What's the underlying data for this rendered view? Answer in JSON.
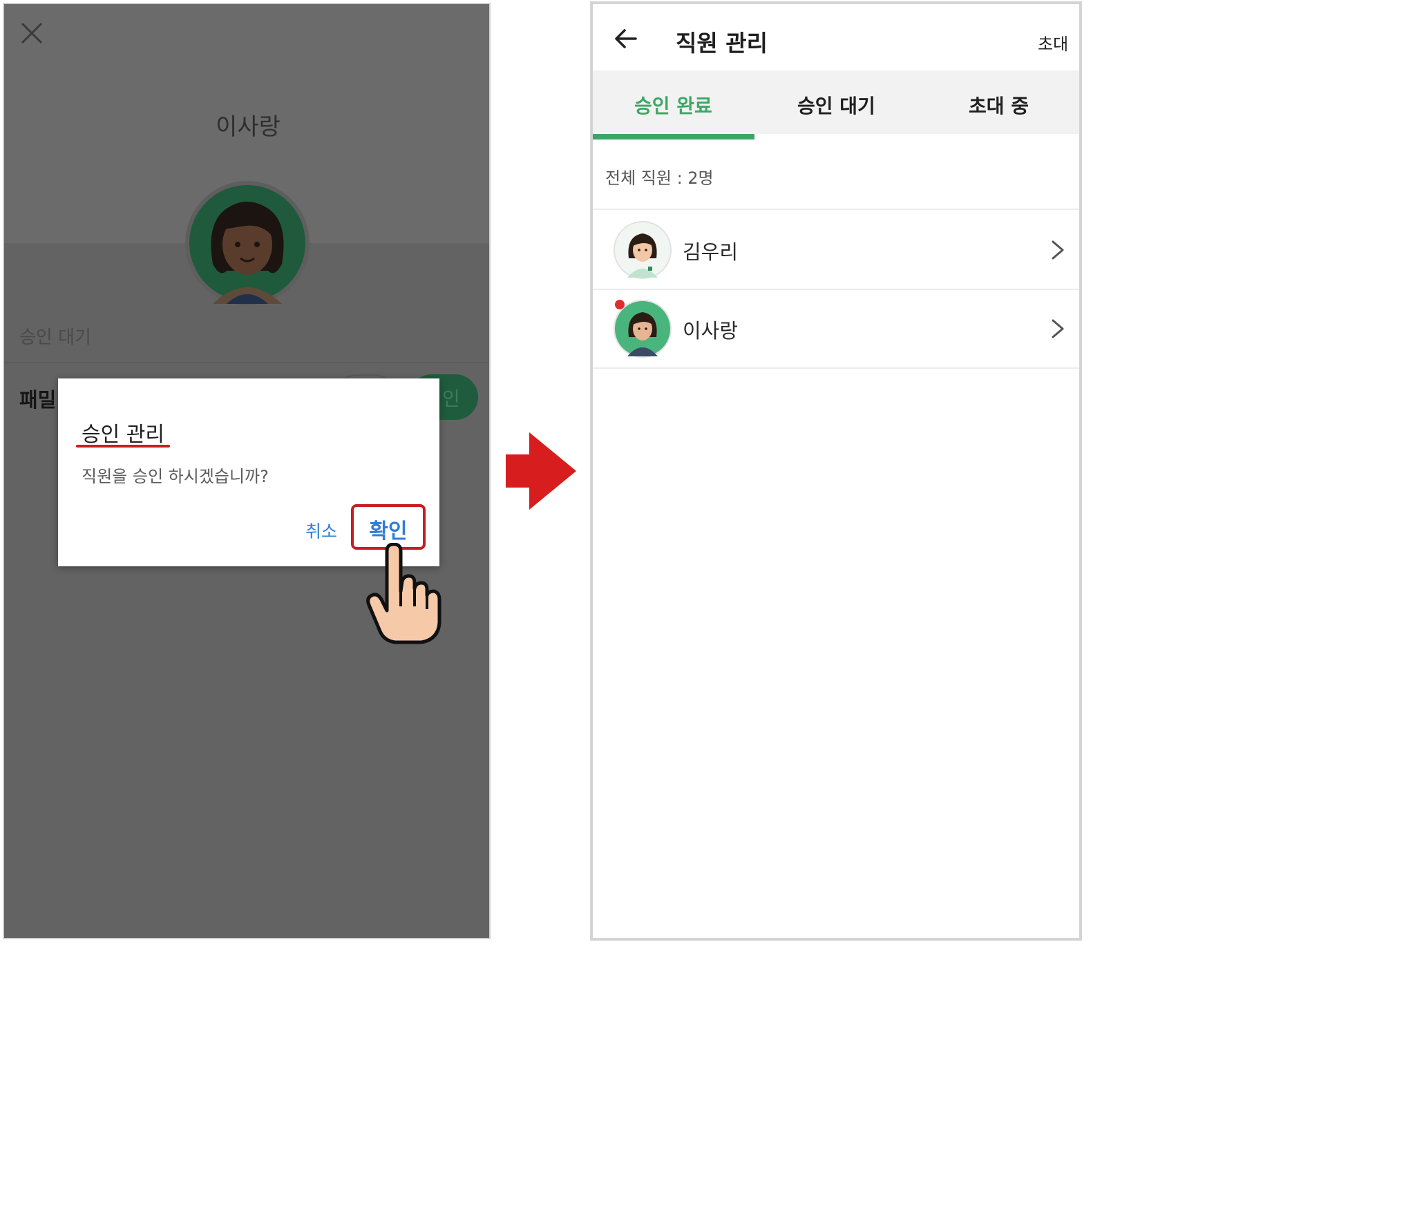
{
  "left_screen": {
    "employee_name": "이사랑",
    "status_label": "승인 대기",
    "family_label_partial": "패밀",
    "approve_pill_partial": "인",
    "dialog": {
      "title": "승인 관리",
      "message": "직원을 승인 하시겠습니까?",
      "cancel_label": "취소",
      "confirm_label": "확인"
    },
    "icons": [
      "close-icon",
      "avatar",
      "hand-pointer-icon"
    ]
  },
  "right_screen": {
    "title": "직원 관리",
    "invite_label": "초대",
    "tabs": [
      {
        "label": "승인 완료",
        "active": true
      },
      {
        "label": "승인 대기",
        "active": false
      },
      {
        "label": "초대 중",
        "active": false
      }
    ],
    "total_label": "전체 직원 : 2명",
    "employees": [
      {
        "name": "김우리",
        "new": false
      },
      {
        "name": "이사랑",
        "new": true
      }
    ],
    "icons": [
      "back-arrow-icon",
      "chevron-right-icon"
    ]
  },
  "colors": {
    "accent_green": "#3aa864",
    "highlight_red": "#c71e24",
    "link_blue": "#2f7dd4",
    "new_dot": "#e12c2c"
  }
}
